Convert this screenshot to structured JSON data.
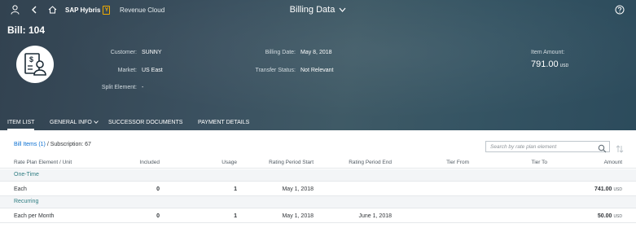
{
  "shellbar": {
    "brand": "SAP Hybris",
    "brand_mark": "Y",
    "product": "Revenue Cloud",
    "title": "Billing Data"
  },
  "header": {
    "bill_title": "Bill: 104",
    "fields": {
      "customer_label": "Customer:",
      "customer_value": "SUNNY",
      "market_label": "Market:",
      "market_value": "US East",
      "split_label": "Split Element:",
      "split_value": "-",
      "billing_date_label": "Billing Date:",
      "billing_date_value": "May 8, 2018",
      "transfer_label": "Transfer Status:",
      "transfer_value": "Not Relevant"
    },
    "amount": {
      "label": "Item Amount:",
      "value": "791.00",
      "currency": "USD"
    }
  },
  "tabs": [
    {
      "label": "ITEM LIST"
    },
    {
      "label": "GENERAL INFO"
    },
    {
      "label": "SUCCESSOR DOCUMENTS"
    },
    {
      "label": "PAYMENT DETAILS"
    }
  ],
  "item_list": {
    "bill_items_link": "Bill Items (1)",
    "subscription": "/ Subscription: 67",
    "search_placeholder": "Search by rate plan element",
    "columns": [
      "Rate Plan Element / Unit",
      "Included",
      "Usage",
      "Rating Period Start",
      "Rating Period End",
      "Tier From",
      "Tier To",
      "Amount"
    ],
    "groups": [
      {
        "name": "One-Time",
        "rows": [
          {
            "unit": "Each",
            "included": "0",
            "usage": "1",
            "start": "May 1, 2018",
            "end": "",
            "tier_from": "",
            "tier_to": "",
            "amount": "741.00",
            "currency": "USD"
          }
        ]
      },
      {
        "name": "Recurring",
        "rows": [
          {
            "unit": "Each per Month",
            "included": "0",
            "usage": "1",
            "start": "May 1, 2018",
            "end": "June 1, 2018",
            "tier_from": "",
            "tier_to": "",
            "amount": "50.00",
            "currency": "USD"
          }
        ]
      }
    ]
  },
  "icons": {
    "user": "user-icon",
    "back": "back-icon",
    "home": "home-icon",
    "help": "help-icon",
    "avatar": "bill-person-icon",
    "search": "search-icon",
    "sort": "sort-icon"
  },
  "colors": {
    "header_bg": "#3b5160",
    "link": "#0a6ed1",
    "group_label": "#2f7d82",
    "text": "#32363a"
  }
}
